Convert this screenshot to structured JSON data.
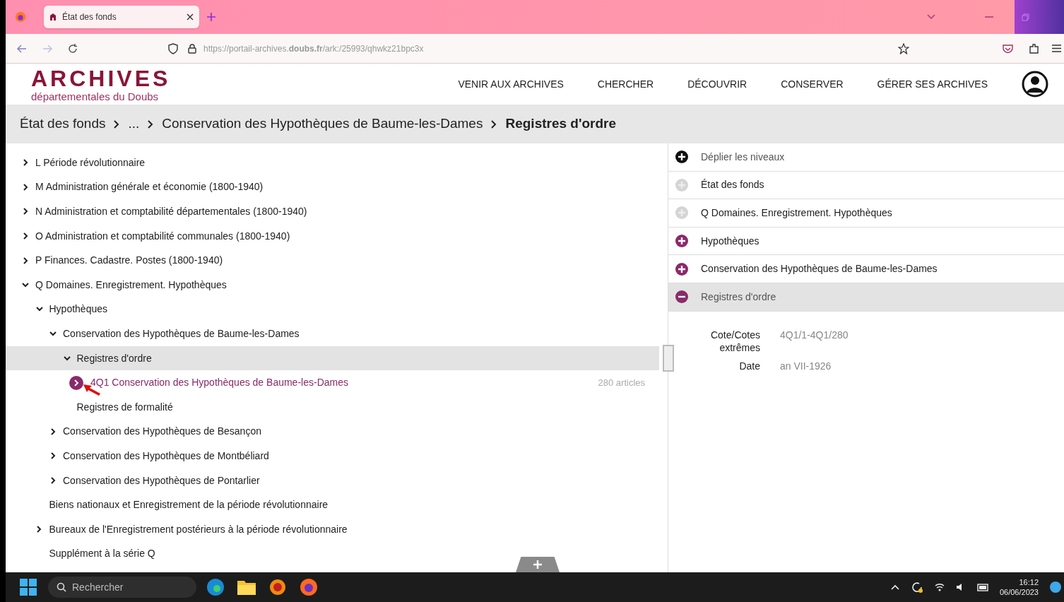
{
  "browser": {
    "tab_title": "État des fonds",
    "url": "https://portail-archives.**doubs.fr**/ark:/25993/qhwkz21bpc3x"
  },
  "site": {
    "logo_title": "ARCHIVES",
    "logo_subtitle": "départementales du Doubs",
    "menu": [
      "VENIR AUX ARCHIVES",
      "CHERCHER",
      "DÉCOUVRIR",
      "CONSERVER",
      "GÉRER SES ARCHIVES"
    ]
  },
  "breadcrumb": [
    "État des fonds",
    "...",
    "Conservation des Hypothèques de Baume-les-Dames",
    "Registres d'ordre"
  ],
  "tree": [
    {
      "label": "L Période révolutionnaire",
      "expanded": false,
      "selected": false
    },
    {
      "label": "M Administration générale et économie (1800-1940)",
      "expanded": false,
      "selected": false
    },
    {
      "label": "N Administration et comptabilité départementales (1800-1940)",
      "expanded": false,
      "selected": false
    },
    {
      "label": "O Administration et comptabilité communales (1800-1940)",
      "expanded": false,
      "selected": false
    },
    {
      "label": "P Finances. Cadastre. Postes (1800-1940)",
      "expanded": false,
      "selected": false
    },
    {
      "label": "Q Domaines. Enregistrement. Hypothèques",
      "expanded": true,
      "selected": false,
      "children": [
        {
          "label": "Hypothèques",
          "expanded": true,
          "selected": false,
          "children": [
            {
              "label": "Conservation des Hypothèques de Baume-les-Dames",
              "expanded": true,
              "selected": false,
              "children": [
                {
                  "label": "Registres d'ordre",
                  "expanded": true,
                  "selected": true,
                  "children": [
                    {
                      "label": "4Q1 Conservation des Hypothèques de Baume-les-Dames",
                      "kind": "record",
                      "count": "280 articles",
                      "selected": false
                    }
                  ]
                },
                {
                  "label": "Registres de formalité",
                  "selected": false
                }
              ]
            },
            {
              "label": "Conservation des Hypothèques de Besançon",
              "expanded": false,
              "selected": false
            },
            {
              "label": "Conservation des Hypothèques de Montbéliard",
              "expanded": false,
              "selected": false
            },
            {
              "label": "Conservation des Hypothèques de Pontarlier",
              "expanded": false,
              "selected": false
            }
          ]
        },
        {
          "label": "Biens nationaux et Enregistrement de la période révolutionnaire",
          "selected": false
        },
        {
          "label": "Bureaux de l'Enregistrement postérieurs à la période révolutionnaire",
          "expanded": false,
          "selected": false
        },
        {
          "label": "Supplément à la série Q",
          "selected": false
        }
      ]
    }
  ],
  "levels": [
    {
      "label": "Déplier les niveaux",
      "kind": "action",
      "selected": false
    },
    {
      "label": "État des fonds",
      "kind": "inactive",
      "selected": false
    },
    {
      "label": "Q Domaines. Enregistrement. Hypothèques",
      "kind": "inactive",
      "selected": false
    },
    {
      "label": "Hypothèques",
      "kind": "open",
      "selected": false
    },
    {
      "label": "Conservation des Hypothèques de Baume-les-Dames",
      "kind": "open",
      "selected": false
    },
    {
      "label": "Registres d'ordre",
      "kind": "current",
      "selected": true
    }
  ],
  "details": [
    {
      "label": "Cote/Cotes extrêmes",
      "value": "4Q1/1-4Q1/280"
    },
    {
      "label": "Date",
      "value": "an VII-1926"
    }
  ],
  "taskbar": {
    "search_placeholder": "Rechercher",
    "time": "16:12",
    "date": "06/06/2023"
  }
}
